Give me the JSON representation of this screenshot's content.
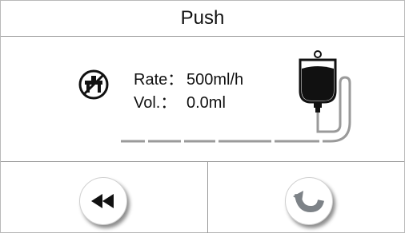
{
  "header": {
    "title": "Push"
  },
  "status": {
    "rate_label": "Rate：",
    "rate_value": "500ml/h",
    "vol_label": "Vol.：",
    "vol_value": "0.0ml"
  },
  "icons": {
    "status_icon": "no-person-icon",
    "bag_icon": "iv-bag-icon",
    "rewind": "rewind-icon",
    "restart": "restart-arrow-icon"
  },
  "colors": {
    "ink": "#111111",
    "arrow_gray": "#7d8287",
    "tube_gray": "#9a9a9a"
  }
}
